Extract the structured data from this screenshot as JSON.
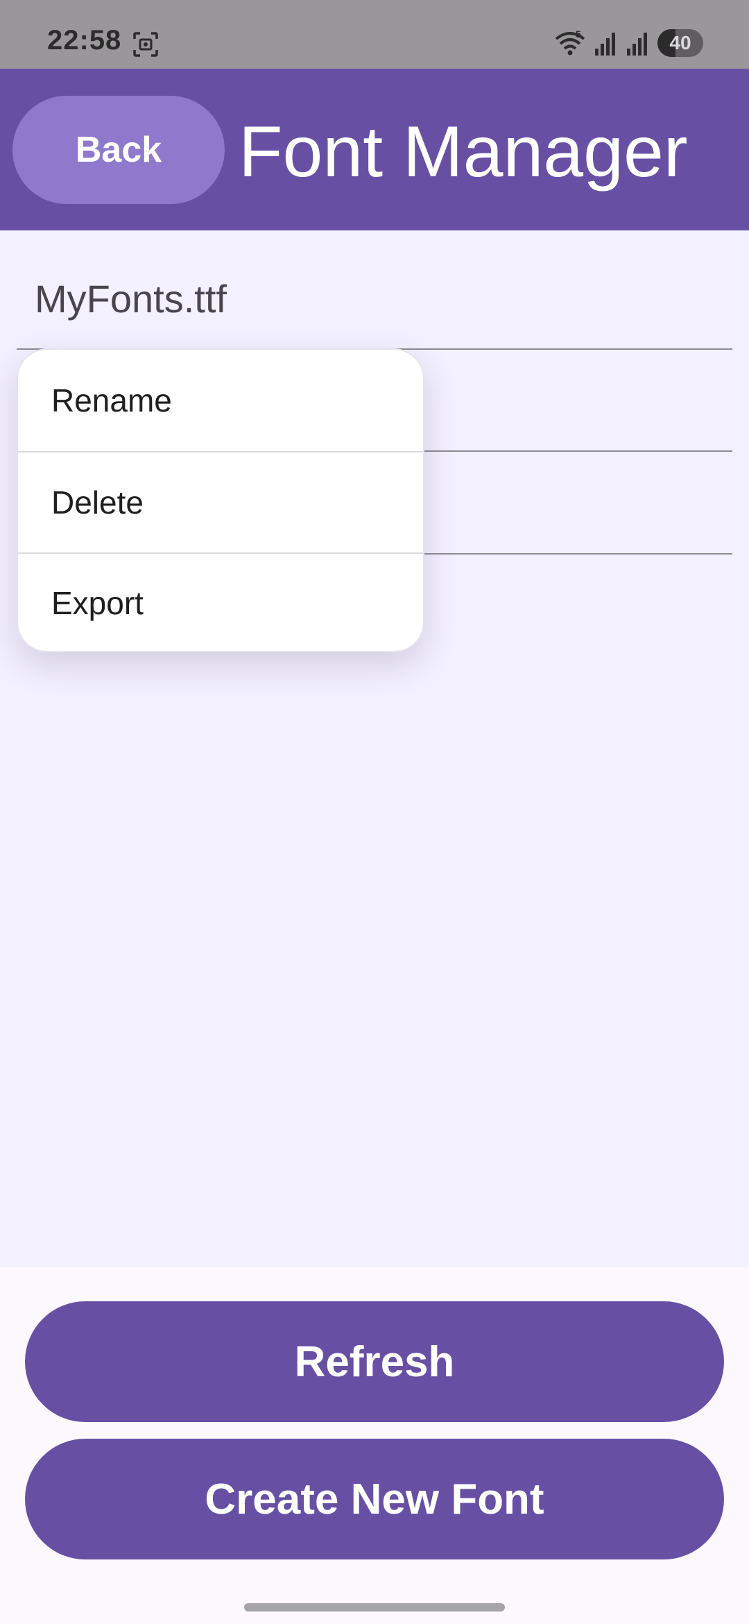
{
  "status_bar": {
    "time": "22:58",
    "battery_level": "40",
    "battery_fraction": 0.4,
    "icons": [
      "screenshot-icon",
      "wifi-icon",
      "signal-icon",
      "signal-icon",
      "battery-icon"
    ]
  },
  "app_bar": {
    "back_label": "Back",
    "title": "Font Manager"
  },
  "font_list": {
    "items": [
      {
        "label": "MyFonts.ttf"
      },
      {
        "label": ""
      },
      {
        "label": ""
      }
    ]
  },
  "context_menu": {
    "items": [
      {
        "label": "Rename"
      },
      {
        "label": "Delete"
      },
      {
        "label": "Export"
      }
    ]
  },
  "actions": {
    "refresh_label": "Refresh",
    "create_label": "Create New Font"
  },
  "colors": {
    "primary": "#6750a4",
    "back_button": "#8f79cc",
    "background": "#f3f0ff",
    "status_bar": "#999799"
  }
}
